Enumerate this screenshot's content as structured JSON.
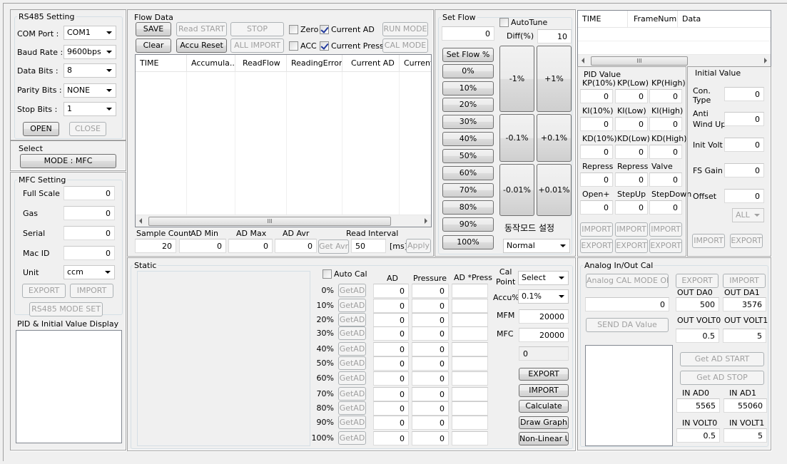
{
  "rs485": {
    "title": "RS485 Setting",
    "com_port_label": "COM  Port :",
    "com_port": "COM1",
    "baud_label": "Baud Rate :",
    "baud": "9600bps",
    "data_bits_label": "Data Bits :",
    "data_bits": "8",
    "parity_label": "Parity Bits :",
    "parity": "NONE",
    "stop_label": "Stop Bits :",
    "stop": "1",
    "open": "OPEN",
    "close": "CLOSE"
  },
  "select": {
    "title": "Select",
    "mode_button": "MODE : MFC"
  },
  "mfc": {
    "title": "MFC Setting",
    "full_scale_label": "Full Scale",
    "full_scale": "0",
    "gas_label": "Gas",
    "gas": "0",
    "serial_label": "Serial",
    "serial": "0",
    "mac_id_label": "Mac ID",
    "mac_id": "0",
    "unit_label": "Unit",
    "unit": "ccm",
    "export": "EXPORT",
    "import": "IMPORT",
    "rs485_mode_set": "RS485 MODE SET",
    "pid_display_label": "PID & Initial Value Display"
  },
  "flow_data": {
    "title": "Flow Data",
    "save": "SAVE",
    "read_start": "Read START",
    "stop": "STOP",
    "clear": "Clear",
    "accu_reset": "Accu Reset",
    "all_import": "ALL IMPORT",
    "zero": "Zero",
    "current_ad": "Current AD",
    "acc": "ACC",
    "current_press": "Current Press",
    "run_mode": "RUN MODE",
    "cal_mode": "CAL MODE",
    "columns": [
      "TIME",
      "Accumula...",
      "ReadFlow",
      "ReadingError",
      "Current AD",
      "Current"
    ],
    "sample_count_label": "Sample Count",
    "sample_count": "20",
    "ad_min_label": "AD Min",
    "ad_min": "0",
    "ad_max_label": "AD Max",
    "ad_max": "0",
    "ad_avr_label": "AD Avr",
    "ad_avr": "0",
    "get_avr": "Get Avr",
    "read_interval_label": "Read Interval",
    "read_interval": "50",
    "ms": "[ms]",
    "apply": "Apply",
    "scroll_grip": "III"
  },
  "set_flow": {
    "title": "Set Flow",
    "value": "0",
    "autotune": "AutoTune",
    "diff_label": "Diff(%)",
    "diff": "10",
    "set_flow_pct": "Set Flow %",
    "percents": [
      "0%",
      "10%",
      "20%",
      "30%",
      "40%",
      "50%",
      "60%",
      "70%",
      "80%",
      "90%",
      "100%"
    ],
    "minus1": "-1%",
    "plus1": "+1%",
    "minus01": "-0.1%",
    "plus01": "+0.1%",
    "minus001": "-0.01%",
    "plus001": "+0.01%",
    "mode_label": "동작모드 설정",
    "mode": "Normal"
  },
  "log": {
    "columns": [
      "TIME",
      "FrameNum",
      "Data"
    ],
    "scroll_grip": "III"
  },
  "pid": {
    "title": "PID Value",
    "rows": [
      {
        "labels": [
          "KP(10%)",
          "KP(Low)",
          "KP(High)"
        ],
        "values": [
          "0",
          "0",
          "0"
        ]
      },
      {
        "labels": [
          "KI(10%)",
          "KI(Low)",
          "KI(High)"
        ],
        "values": [
          "0",
          "0",
          "0"
        ]
      },
      {
        "labels": [
          "KD(10%)",
          "KD(Low)",
          "KD(High)"
        ],
        "values": [
          "0",
          "0",
          "0"
        ]
      },
      {
        "labels": [
          "Repress",
          "Repress",
          "Valve"
        ],
        "values": [
          "0",
          "0",
          "0"
        ]
      },
      {
        "labels": [
          "Open+",
          "StepUp",
          "StepDown"
        ],
        "values": [
          "0",
          "0",
          "0"
        ]
      }
    ],
    "import": "IMPORT",
    "export": "EXPORT"
  },
  "initial": {
    "title": "Initial Value",
    "con_type_label": "Con.\nType",
    "con_type": "0",
    "anti_windup_label": "Anti\nWind Up",
    "anti_windup": "0",
    "init_volt_label": "Init Volt",
    "init_volt": "0",
    "fs_gain_label": "FS Gain",
    "fs_gain": "0",
    "offset_label": "Offset",
    "offset": "0",
    "scope": "ALL",
    "import": "IMPORT",
    "export": "EXPORT"
  },
  "static": {
    "title": "Static",
    "auto_cal": "Auto Cal",
    "col_ad": "AD",
    "col_pressure": "Pressure",
    "col_ad_press": "AD *Press",
    "get_ad": "GetAD",
    "rows": [
      {
        "pct": "0%",
        "ad": "0",
        "pressure": "0",
        "ad_press": ""
      },
      {
        "pct": "10%",
        "ad": "0",
        "pressure": "0",
        "ad_press": ""
      },
      {
        "pct": "20%",
        "ad": "0",
        "pressure": "0",
        "ad_press": ""
      },
      {
        "pct": "30%",
        "ad": "0",
        "pressure": "0",
        "ad_press": ""
      },
      {
        "pct": "40%",
        "ad": "0",
        "pressure": "0",
        "ad_press": ""
      },
      {
        "pct": "50%",
        "ad": "0",
        "pressure": "0",
        "ad_press": ""
      },
      {
        "pct": "60%",
        "ad": "0",
        "pressure": "0",
        "ad_press": ""
      },
      {
        "pct": "70%",
        "ad": "0",
        "pressure": "0",
        "ad_press": ""
      },
      {
        "pct": "80%",
        "ad": "0",
        "pressure": "0",
        "ad_press": ""
      },
      {
        "pct": "90%",
        "ad": "0",
        "pressure": "0",
        "ad_press": ""
      },
      {
        "pct": "100%",
        "ad": "0",
        "pressure": "0",
        "ad_press": ""
      }
    ],
    "cal_point_label": "Cal\nPoint",
    "cal_point": "Select",
    "accu_label": "Accu%",
    "accu": "0.1%",
    "mfm_label": "MFM",
    "mfm": "20000",
    "mfc_label": "MFC",
    "mfc": "20000",
    "result": "0",
    "export": "EXPORT",
    "import": "IMPORT",
    "calculate": "Calculate",
    "draw_graph": "Draw Graph",
    "non_linear_up": "Non-Linear UP"
  },
  "analog": {
    "title": "Analog In/Out Cal",
    "cal_mode_on": "Analog CAL MODE ON",
    "export": "EXPORT",
    "import": "IMPORT",
    "da_value": "0",
    "out_da0_label": "OUT DA0",
    "out_da0": "500",
    "out_da1_label": "OUT DA1",
    "out_da1": "3576",
    "send_da": "SEND DA Value",
    "out_volt0_label": "OUT VOLT0",
    "out_volt0": "0.5",
    "out_volt1_label": "OUT VOLT1",
    "out_volt1": "5",
    "get_ad_start": "Get AD START",
    "get_ad_stop": "Get AD STOP",
    "in_ad0_label": "IN AD0",
    "in_ad0": "5565",
    "in_ad1_label": "IN AD1",
    "in_ad1": "55060",
    "in_volt0_label": "IN VOLT0",
    "in_volt0": "0.5",
    "in_volt1_label": "IN VOLT1",
    "in_volt1": "5"
  }
}
